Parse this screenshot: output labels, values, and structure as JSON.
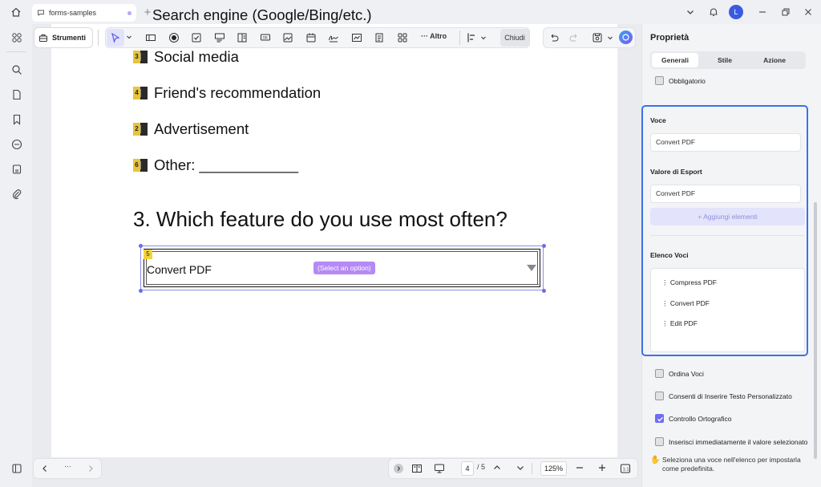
{
  "window": {
    "tab_title": "forms-samples",
    "avatar_initial": "L",
    "accent_color": "#6e6cf0"
  },
  "toolbar": {
    "tools_label": "Strumenti",
    "more_label": "Altro",
    "close_label": "Chiudi"
  },
  "document": {
    "top_cut_text": "Search engine (Google/Bing/etc.)",
    "options": [
      {
        "number": "3",
        "label": "Social media"
      },
      {
        "number": "4",
        "label": "Friend's recommendation"
      },
      {
        "number": "2",
        "label": "Advertisement"
      },
      {
        "number": "6",
        "label": "Other: ____________"
      }
    ],
    "question": "3. Which feature do you use most often?",
    "dropdown": {
      "badge": "5",
      "value": "Convert PDF",
      "placeholder": "(Select an option)"
    }
  },
  "bottom_bar": {
    "nav_more": "···",
    "page_current": "4",
    "page_total": "/ 5",
    "zoom": "125%"
  },
  "panel": {
    "title": "Proprietà",
    "tabs": [
      "Generali",
      "Stile",
      "Azione"
    ],
    "required_label": "Obbligatorio",
    "item_label": "Voce",
    "item_value": "Convert PDF",
    "export_label": "Valore di Esport",
    "export_value": "Convert PDF",
    "add_button": "+ Aggiungi elementi",
    "list_label": "Elenco Voci",
    "list_items": [
      "Compress PDF",
      "Convert PDF",
      "Edit PDF"
    ],
    "checkboxes": [
      {
        "label": "Ordina Voci",
        "checked": false
      },
      {
        "label": "Consenti di Inserire Testo Personalizzato",
        "checked": false
      },
      {
        "label": "Controllo Ortografico",
        "checked": true
      },
      {
        "label": "Inserisci immediatamente il valore selezionato",
        "checked": false
      }
    ],
    "hint": "Seleziona una voce nell'elenco per impostarla come predefinita."
  }
}
